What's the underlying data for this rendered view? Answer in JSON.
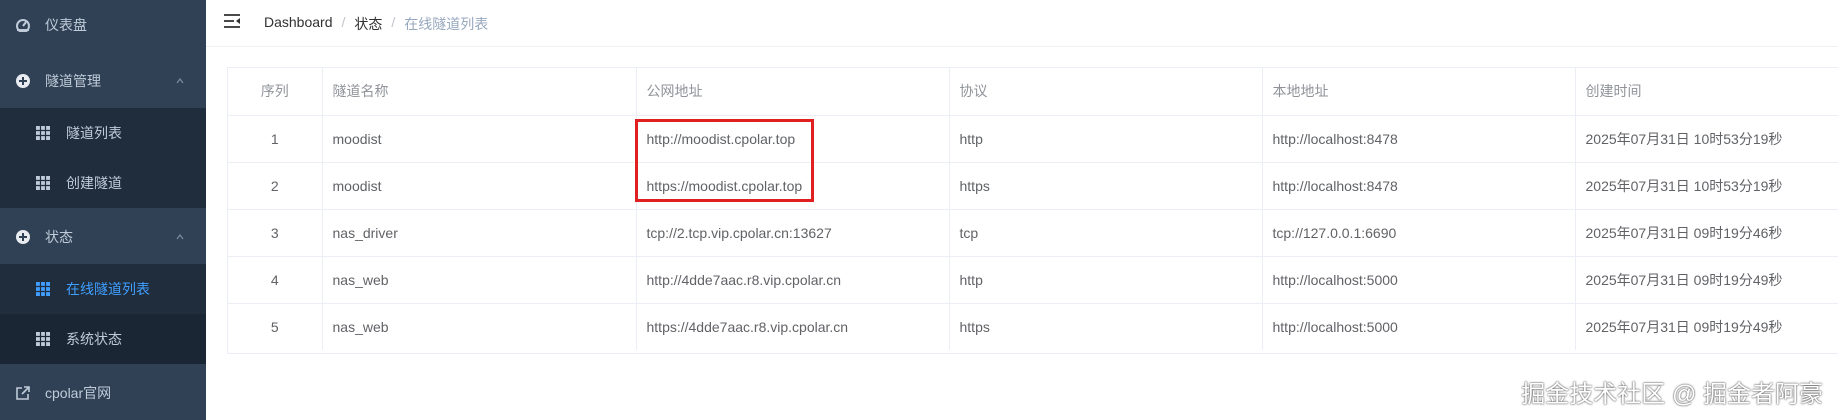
{
  "sidebar": {
    "items": [
      {
        "label": "仪表盘",
        "icon": "dashboard-icon"
      },
      {
        "label": "隧道管理",
        "icon": "plus-circle-icon"
      },
      {
        "label": "隧道列表",
        "icon": "grid-icon"
      },
      {
        "label": "创建隧道",
        "icon": "grid-icon"
      },
      {
        "label": "状态",
        "icon": "plus-circle-icon"
      },
      {
        "label": "在线隧道列表",
        "icon": "grid-icon"
      },
      {
        "label": "系统状态",
        "icon": "grid-icon"
      },
      {
        "label": "cpolar官网",
        "icon": "external-link-icon"
      }
    ]
  },
  "breadcrumb": [
    "Dashboard",
    "状态",
    "在线隧道列表"
  ],
  "table": {
    "headers": [
      "序列",
      "隧道名称",
      "公网地址",
      "协议",
      "本地地址",
      "创建时间"
    ],
    "rows": [
      [
        "1",
        "moodist",
        "http://moodist.cpolar.top",
        "http",
        "http://localhost:8478",
        "2025年07月31日 10时53分19秒"
      ],
      [
        "2",
        "moodist",
        "https://moodist.cpolar.top",
        "https",
        "http://localhost:8478",
        "2025年07月31日 10时53分19秒"
      ],
      [
        "3",
        "nas_driver",
        "tcp://2.tcp.vip.cpolar.cn:13627",
        "tcp",
        "tcp://127.0.0.1:6690",
        "2025年07月31日 09时19分46秒"
      ],
      [
        "4",
        "nas_web",
        "http://4dde7aac.r8.vip.cpolar.cn",
        "http",
        "http://localhost:5000",
        "2025年07月31日 09时19分49秒"
      ],
      [
        "5",
        "nas_web",
        "https://4dde7aac.r8.vip.cpolar.cn",
        "https",
        "http://localhost:5000",
        "2025年07月31日 09时19分49秒"
      ]
    ]
  },
  "watermark": "掘金技术社区 @ 掘金者阿豪",
  "colors": {
    "sidebar": "#304156",
    "submenu": "#1f2d3d",
    "active": "#409eff",
    "highlight": "#e02020"
  }
}
